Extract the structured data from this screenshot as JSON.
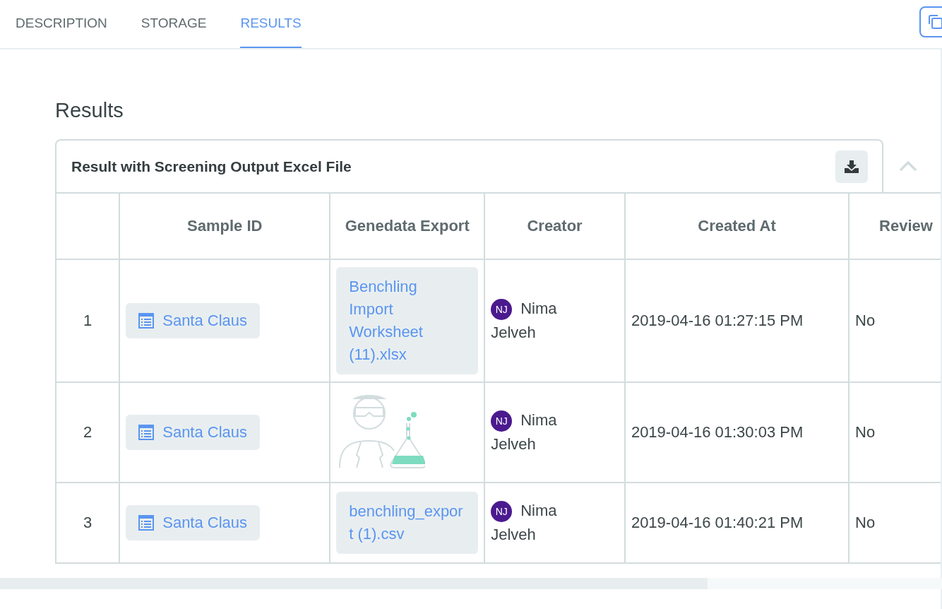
{
  "tabs": [
    {
      "label": "DESCRIPTION",
      "selected": false
    },
    {
      "label": "STORAGE",
      "selected": false
    },
    {
      "label": "RESULTS",
      "selected": true
    }
  ],
  "section_title": "Results",
  "result_card": {
    "title": "Result with Screening Output Excel File",
    "expanded": true,
    "columns": [
      "Sample ID",
      "Genedata Export",
      "Creator",
      "Created At",
      "Review"
    ],
    "rows": [
      {
        "number": "1",
        "sample_id": "Santa Claus",
        "genedata_export": {
          "kind": "file",
          "name": "Benchling Import Worksheet (11).xlsx"
        },
        "creator": {
          "initials": "NJ",
          "name": "Nima Jelveh"
        },
        "created_at": "2019-04-16 01:27:15 PM",
        "review": "No"
      },
      {
        "number": "2",
        "sample_id": "Santa Claus",
        "genedata_export": {
          "kind": "illustration"
        },
        "creator": {
          "initials": "NJ",
          "name": "Nima Jelveh"
        },
        "created_at": "2019-04-16 01:30:03 PM",
        "review": "No"
      },
      {
        "number": "3",
        "sample_id": "Santa Claus",
        "genedata_export": {
          "kind": "file",
          "name": "benchling_export (1).csv"
        },
        "creator": {
          "initials": "NJ",
          "name": "Nima Jelveh"
        },
        "created_at": "2019-04-16 01:40:21 PM",
        "review": "No"
      }
    ]
  }
}
